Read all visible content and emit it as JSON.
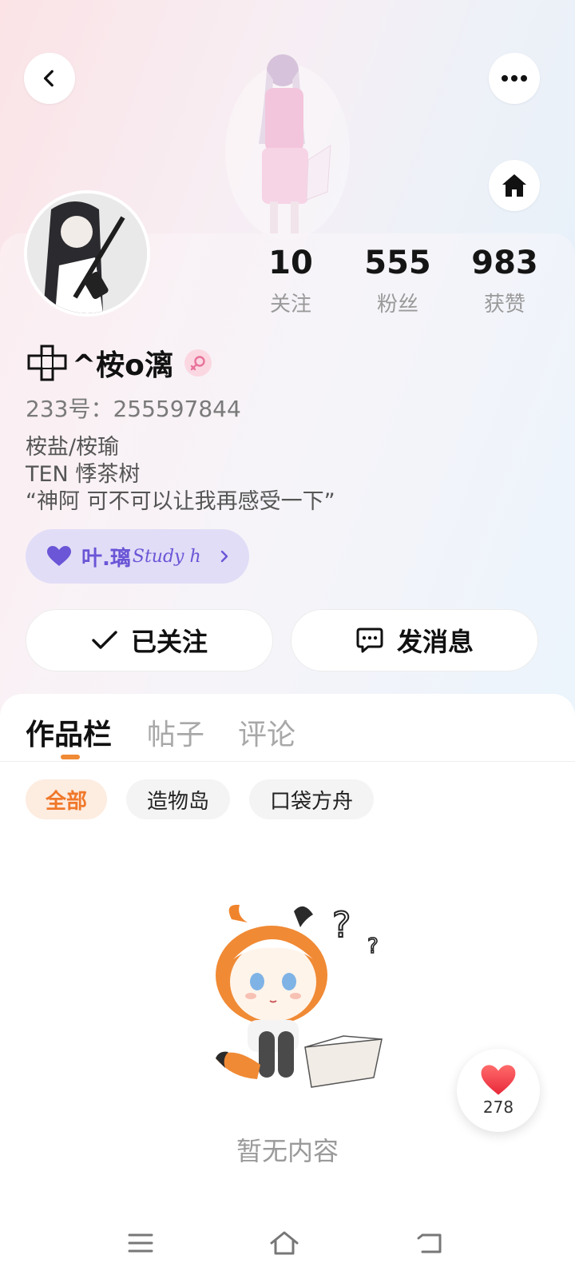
{
  "colors": {
    "accent_orange": "#f08a35",
    "fan_purple": "#6a56d6",
    "gender_pink": "#e8739a",
    "heart_red": "#f0494e"
  },
  "header": {
    "back_icon": "chevron-left-icon",
    "more_icon": "more-horizontal-icon",
    "home_icon": "home-icon"
  },
  "stats": [
    {
      "value": "10",
      "label": "关注"
    },
    {
      "value": "555",
      "label": "粉丝"
    },
    {
      "value": "983",
      "label": "获赞"
    }
  ],
  "profile": {
    "name": "^桉o漓",
    "gender_icon": "female-icon",
    "uid": "233号：255597844",
    "bio": [
      "桉盐/桉瑜",
      "TEN 悸茶树",
      "“神阿 可不可以让我再感受一下”"
    ]
  },
  "fan_badge": {
    "icon": "heart-icon",
    "text": "叶.璃",
    "script": "Study h"
  },
  "actions": {
    "follow_label": "已关注",
    "message_label": "发消息"
  },
  "tabs": [
    {
      "label": "作品栏"
    },
    {
      "label": "帖子"
    },
    {
      "label": "评论"
    }
  ],
  "filters": [
    {
      "label": "全部"
    },
    {
      "label": "造物岛"
    },
    {
      "label": "口袋方舟"
    }
  ],
  "empty": {
    "text": "暂无内容"
  },
  "like": {
    "count": "278"
  },
  "navbar": {
    "menu_icon": "menu-icon",
    "home_icon": "home-outline-icon",
    "back_icon": "back-icon"
  }
}
